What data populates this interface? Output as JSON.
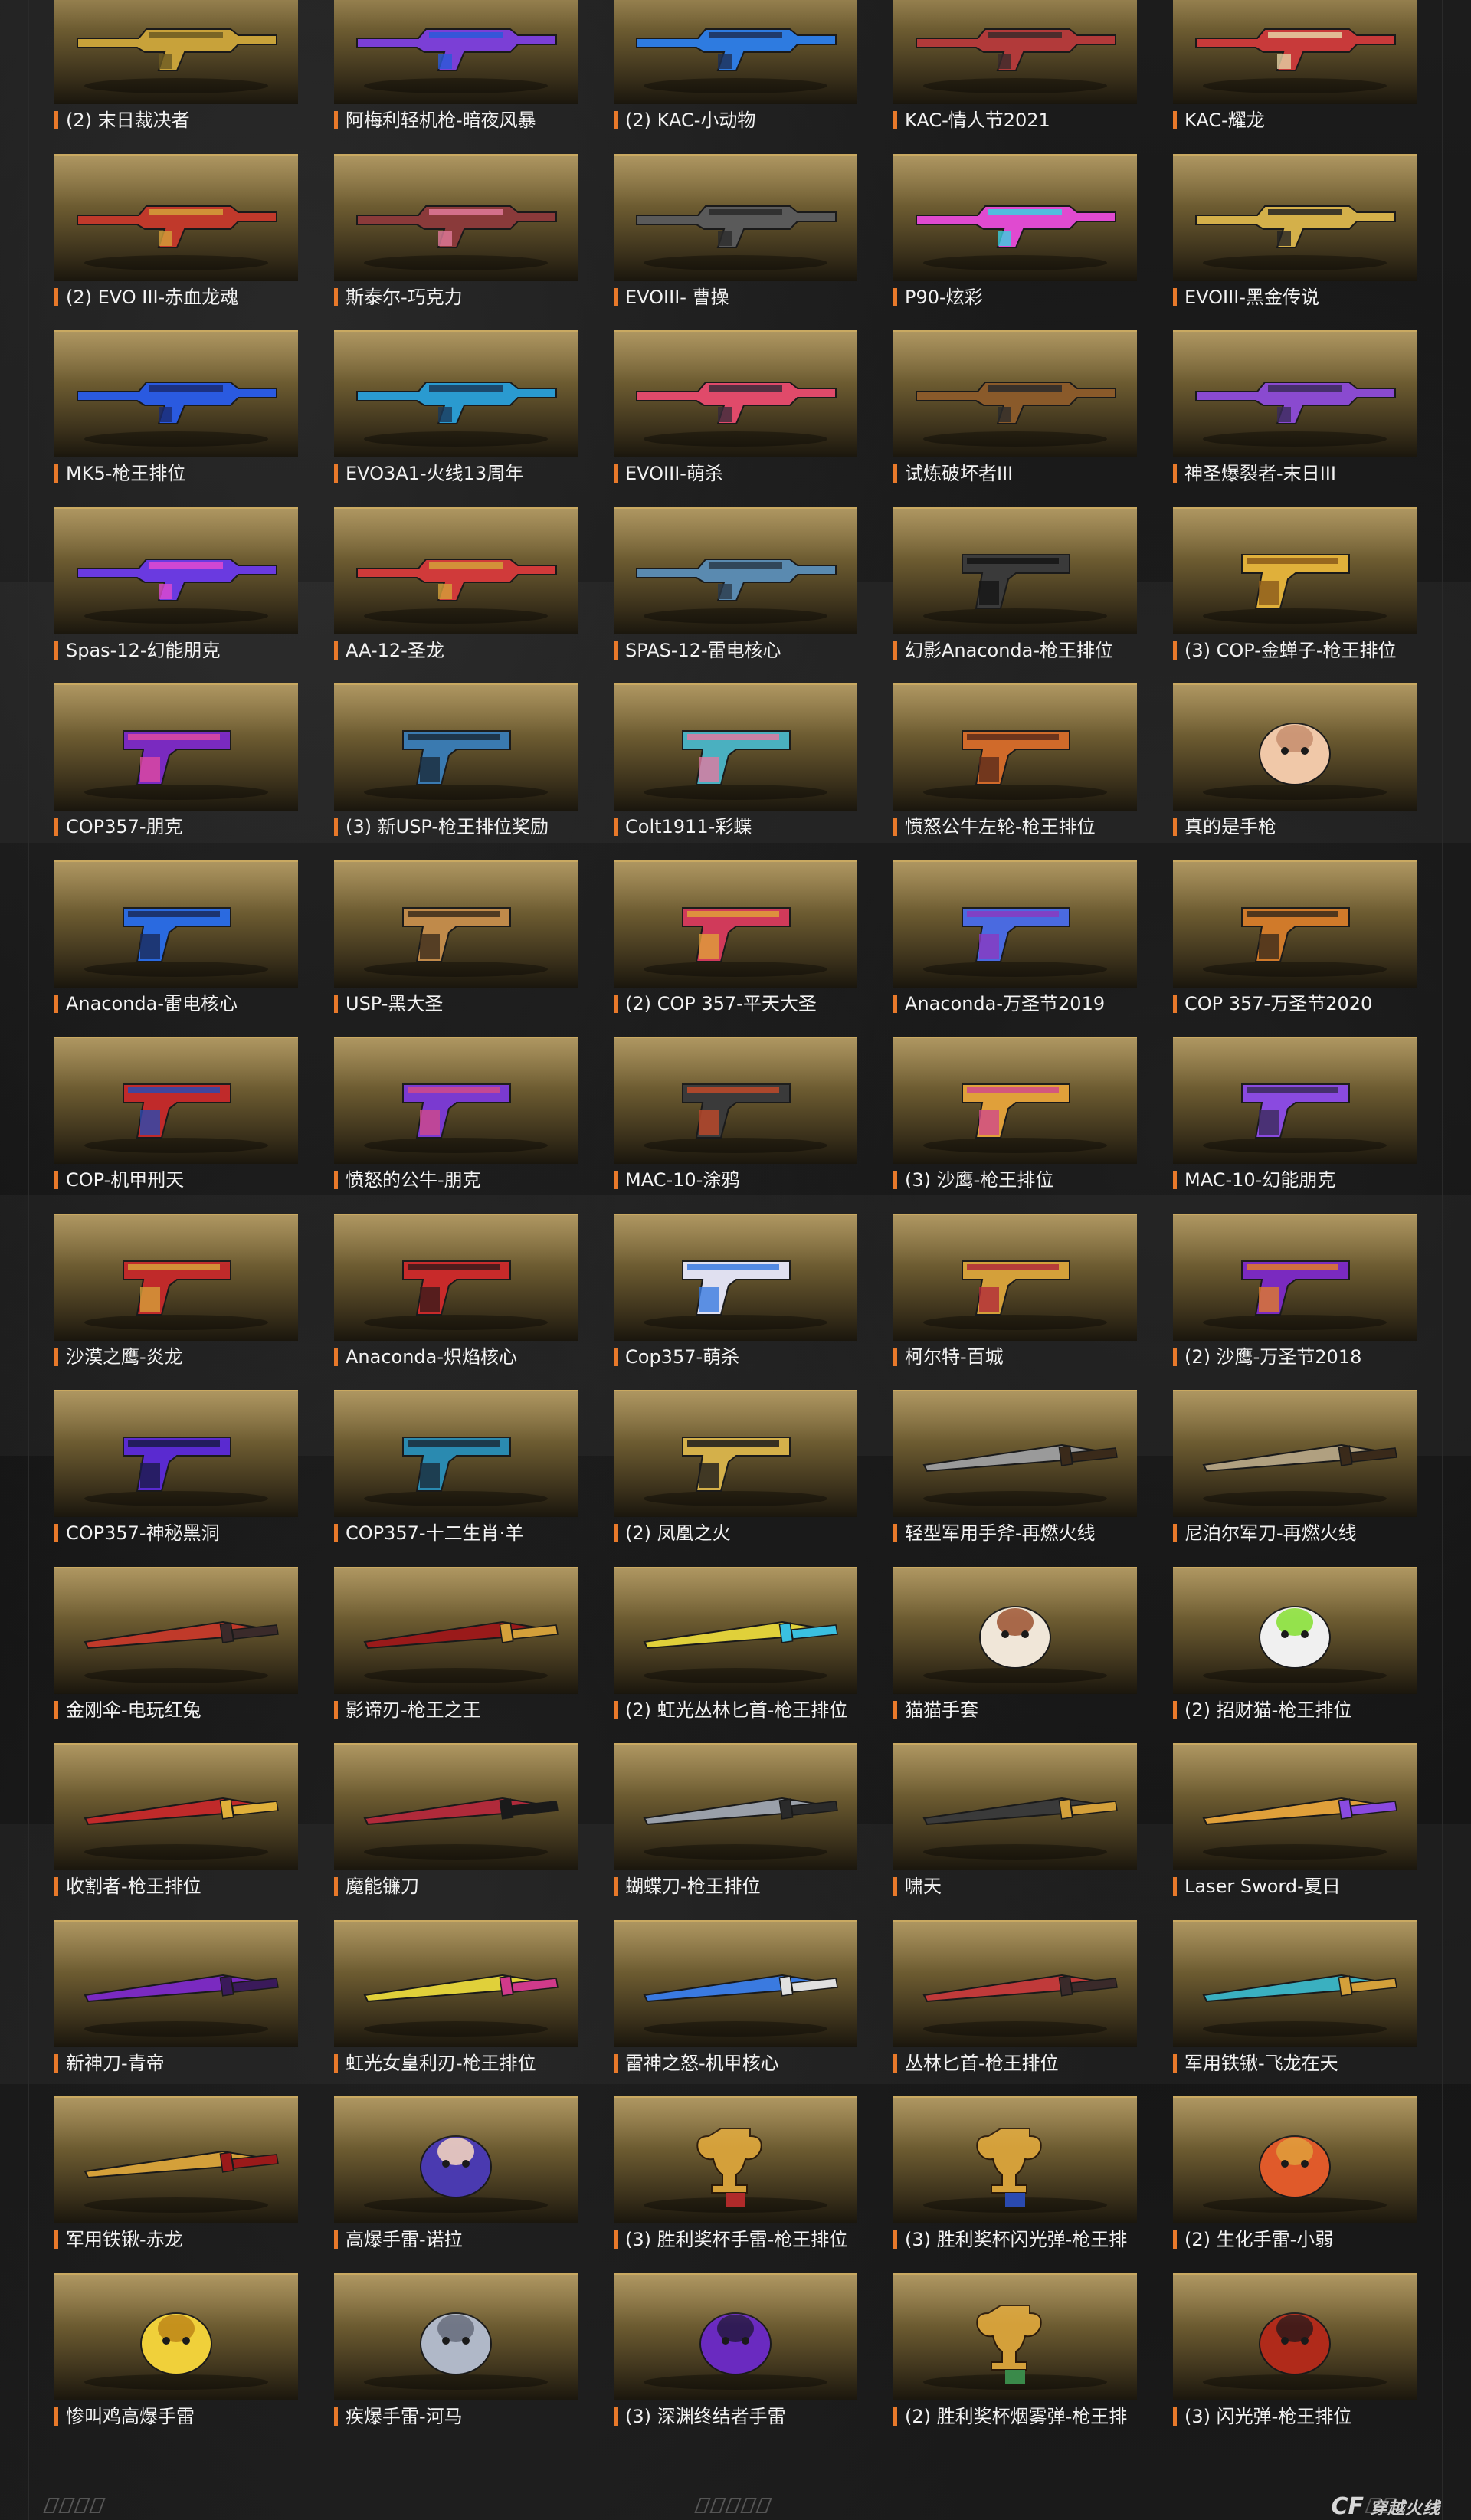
{
  "items": [
    {
      "label": "(2) 末日裁决者",
      "icon": "machine-gun-gold-icon",
      "colors": [
        "#c8a23a",
        "#6b5a22"
      ]
    },
    {
      "label": "阿梅利轻机枪-暗夜风暴",
      "icon": "machine-gun-purple-icon",
      "colors": [
        "#7b3fd6",
        "#2a5ad8"
      ]
    },
    {
      "label": "(2) KAC-小动物",
      "icon": "rifle-blue-icon",
      "colors": [
        "#2e7be0",
        "#1d2f55"
      ]
    },
    {
      "label": "KAC-情人节2021",
      "icon": "rifle-red-icon",
      "colors": [
        "#b23a3a",
        "#3a2a2a"
      ]
    },
    {
      "label": "KAC-耀龙",
      "icon": "rifle-red-white-icon",
      "colors": [
        "#c83a3a",
        "#e5d2a5"
      ]
    },
    {
      "label": "(2) EVO III-赤血龙魂",
      "icon": "smg-red-gold-icon",
      "colors": [
        "#c0392b",
        "#d4a03a"
      ]
    },
    {
      "label": "斯泰尔-巧克力",
      "icon": "smg-chocolate-icon",
      "colors": [
        "#8a3a3a",
        "#e07a9a"
      ]
    },
    {
      "label": "EVOIII- 曹操",
      "icon": "smg-grey-icon",
      "colors": [
        "#5a5a5a",
        "#2a2a2a"
      ]
    },
    {
      "label": "P90-炫彩",
      "icon": "p90-rainbow-icon",
      "colors": [
        "#e04ad0",
        "#3ad0e0"
      ]
    },
    {
      "label": "EVOIII-黑金传说",
      "icon": "smg-black-gold-icon",
      "colors": [
        "#d4b04a",
        "#222222"
      ]
    },
    {
      "label": "MK5-枪王排位",
      "icon": "smg-blue-icon",
      "colors": [
        "#2a5ae0",
        "#1a2a70"
      ]
    },
    {
      "label": "EVO3A1-火线13周年",
      "icon": "smg-cyan-icon",
      "colors": [
        "#2a9ad0",
        "#1a3a5a"
      ]
    },
    {
      "label": "EVOIII-萌杀",
      "icon": "smg-pink-icon",
      "colors": [
        "#e04a6a",
        "#3a2a3a"
      ]
    },
    {
      "label": "试炼破坏者III",
      "icon": "shotgun-brown-icon",
      "colors": [
        "#8a5a2a",
        "#2a2a2a"
      ]
    },
    {
      "label": "神圣爆裂者-末日III",
      "icon": "shotgun-purple-icon",
      "colors": [
        "#8a4ad0",
        "#3a2a5a"
      ]
    },
    {
      "label": "Spas-12-幻能朋克",
      "icon": "shotgun-neon-icon",
      "colors": [
        "#6a3ae0",
        "#e04ad0"
      ]
    },
    {
      "label": "AA-12-圣龙",
      "icon": "shotgun-red-gold-icon",
      "colors": [
        "#d03a3a",
        "#d4a03a"
      ]
    },
    {
      "label": "SPAS-12-雷电核心",
      "icon": "shotgun-steel-blue-icon",
      "colors": [
        "#5a8ab0",
        "#2a3a4a"
      ]
    },
    {
      "label": "幻影Anaconda-枪王排位",
      "icon": "revolver-black-icon",
      "colors": [
        "#3a3a3a",
        "#151515"
      ]
    },
    {
      "label": "(3) COP-金蝉子-枪王排位",
      "icon": "pistol-gold-icon",
      "colors": [
        "#e0b03a",
        "#8a5a1a"
      ]
    },
    {
      "label": "COP357-朋克",
      "icon": "pistol-purple-icon",
      "colors": [
        "#7a2ac0",
        "#e04aa0"
      ]
    },
    {
      "label": "(3) 新USP-枪王排位奖励",
      "icon": "pistol-blue-icon",
      "colors": [
        "#3a7ab0",
        "#1a2a3a"
      ]
    },
    {
      "label": "Colt1911-彩蝶",
      "icon": "pistol-teal-icon",
      "colors": [
        "#4ab0c0",
        "#e07aa0"
      ]
    },
    {
      "label": "愤怒公牛左轮-枪王排位",
      "icon": "revolver-orange-icon",
      "colors": [
        "#d06a2a",
        "#5a2a1a"
      ]
    },
    {
      "label": "真的是手枪",
      "icon": "hand-gesture-icon",
      "colors": [
        "#f0c8a8",
        "#c89070"
      ]
    },
    {
      "label": "Anaconda-雷电核心",
      "icon": "revolver-blue-icon",
      "colors": [
        "#2a6ae0",
        "#1a2a5a"
      ]
    },
    {
      "label": "USP-黑大圣",
      "icon": "pistol-small-gold-icon",
      "colors": [
        "#c08a4a",
        "#3a2a1a"
      ]
    },
    {
      "label": "(2) COP 357-平天大圣",
      "icon": "pistol-red-icon",
      "colors": [
        "#d03a5a",
        "#e0a03a"
      ]
    },
    {
      "label": "Anaconda-万圣节2019",
      "icon": "revolver-purple-blue-icon",
      "colors": [
        "#4a6ae0",
        "#8a3ac0"
      ]
    },
    {
      "label": "COP 357-万圣节2020",
      "icon": "pistol-orange-icon",
      "colors": [
        "#d07a2a",
        "#3a2a1a"
      ]
    },
    {
      "label": "COP-机甲刑天",
      "icon": "pistol-red-blue-icon",
      "colors": [
        "#c02a2a",
        "#2a4ab0"
      ]
    },
    {
      "label": "愤怒的公牛-朋克",
      "icon": "revolver-neon-icon",
      "colors": [
        "#7a3ad0",
        "#d04a8a"
      ]
    },
    {
      "label": "MAC-10-涂鸦",
      "icon": "mac10-dark-icon",
      "colors": [
        "#3a3a3a",
        "#c04a2a"
      ]
    },
    {
      "label": "(3) 沙鹰-枪王排位",
      "icon": "deagle-rainbow-icon",
      "colors": [
        "#e0a03a",
        "#d04a8a"
      ]
    },
    {
      "label": "MAC-10-幻能朋克",
      "icon": "mac10-purple-icon",
      "colors": [
        "#8a4ae0",
        "#3a2a5a"
      ]
    },
    {
      "label": "沙漠之鹰-炎龙",
      "icon": "deagle-red-gold-icon",
      "colors": [
        "#c02a2a",
        "#d4a03a"
      ]
    },
    {
      "label": "Anaconda-炽焰核心",
      "icon": "revolver-red-icon",
      "colors": [
        "#c82a2a",
        "#3a1a1a"
      ]
    },
    {
      "label": "Cop357-萌杀",
      "icon": "pistol-white-blue-icon",
      "colors": [
        "#e0e0f0",
        "#3a7ae0"
      ]
    },
    {
      "label": "柯尔特-百城",
      "icon": "pistol-gold-red-icon",
      "colors": [
        "#d4a03a",
        "#b02a3a"
      ]
    },
    {
      "label": "(2) 沙鹰-万圣节2018",
      "icon": "deagle-purple-orange-icon",
      "colors": [
        "#7a2ac0",
        "#e07a2a"
      ]
    },
    {
      "label": "COP357-神秘黑洞",
      "icon": "pistol-violet-icon",
      "colors": [
        "#5a2ad0",
        "#1a1a4a"
      ]
    },
    {
      "label": "COP357-十二生肖·羊",
      "icon": "pistol-teal-dark-icon",
      "colors": [
        "#2a8ab0",
        "#1a2a3a"
      ]
    },
    {
      "label": "(2) 凤凰之火",
      "icon": "deagle-gold-black-icon",
      "colors": [
        "#d4b04a",
        "#1a1a1a"
      ]
    },
    {
      "label": "轻型军用手斧-再燃火线",
      "icon": "hatchet-icon",
      "colors": [
        "#9a9a9a",
        "#3a2a1a"
      ]
    },
    {
      "label": "尼泊尔军刀-再燃火线",
      "icon": "kukri-icon",
      "colors": [
        "#b0a080",
        "#3a2a1a"
      ]
    },
    {
      "label": "金刚伞-电玩红兔",
      "icon": "umbrella-icon",
      "colors": [
        "#c03a2a",
        "#3a2a2a"
      ]
    },
    {
      "label": "影谛刃-枪王之王",
      "icon": "twin-blade-icon",
      "colors": [
        "#9a1a1a",
        "#d4a03a"
      ]
    },
    {
      "label": "(2) 虹光丛林匕首-枪王排位",
      "icon": "rainbow-knife-icon",
      "colors": [
        "#e0d03a",
        "#3ac0e0"
      ]
    },
    {
      "label": "猫猫手套",
      "icon": "cat-paw-icon",
      "colors": [
        "#f0e6d8",
        "#a05a3a"
      ]
    },
    {
      "label": "(2) 招财猫-枪王排位",
      "icon": "rainbow-paw-icon",
      "colors": [
        "#f0f0f0",
        "#8ae03a"
      ]
    },
    {
      "label": "收割者-枪王排位",
      "icon": "reaper-axe-icon",
      "colors": [
        "#c02a2a",
        "#e0b03a"
      ]
    },
    {
      "label": "魔能镰刀",
      "icon": "scythe-icon",
      "colors": [
        "#b02a3a",
        "#1a1a1a"
      ]
    },
    {
      "label": "蝴蝶刀-枪王排位",
      "icon": "butterfly-knife-icon",
      "colors": [
        "#9aa0aa",
        "#2a2a2a"
      ]
    },
    {
      "label": "啸天",
      "icon": "wolf-claw-icon",
      "colors": [
        "#3a3a3a",
        "#d4a03a"
      ]
    },
    {
      "label": "Laser Sword-夏日",
      "icon": "laser-sword-icon",
      "colors": [
        "#e0a03a",
        "#8a4ae0"
      ]
    },
    {
      "label": "新神刀-青帝",
      "icon": "katana-purple-icon",
      "colors": [
        "#7a2ac0",
        "#3a1a5a"
      ]
    },
    {
      "label": "虹光女皇利刃-枪王排位",
      "icon": "rainbow-twin-blade-icon",
      "colors": [
        "#e0d03a",
        "#d03a8a"
      ]
    },
    {
      "label": "雷神之怒-机甲核心",
      "icon": "mech-hammer-icon",
      "colors": [
        "#3a7ae0",
        "#e0e0e0"
      ]
    },
    {
      "label": "丛林匕首-枪王排位",
      "icon": "jungle-knife-icon",
      "colors": [
        "#c03a3a",
        "#3a2a2a"
      ]
    },
    {
      "label": "军用铁锹-飞龙在天",
      "icon": "shovel-teal-icon",
      "colors": [
        "#3ab0c0",
        "#d4a03a"
      ]
    },
    {
      "label": "军用铁锹-赤龙",
      "icon": "shovel-red-gold-icon",
      "colors": [
        "#d4a03a",
        "#9a1a1a"
      ]
    },
    {
      "label": "高爆手雷-诺拉",
      "icon": "doll-grenade-icon",
      "colors": [
        "#4a3ab0",
        "#f0d0c0"
      ]
    },
    {
      "label": "(3) 胜利奖杯手雷-枪王排位",
      "icon": "trophy-red-icon",
      "colors": [
        "#d4a03a",
        "#b02a2a"
      ]
    },
    {
      "label": "(3) 胜利奖杯闪光弹-枪王排",
      "icon": "trophy-blue-icon",
      "colors": [
        "#d4a03a",
        "#2a4ab0"
      ]
    },
    {
      "label": "(2) 生化手雷-小弱",
      "icon": "demon-grenade-icon",
      "colors": [
        "#e05a2a",
        "#e09a3a"
      ]
    },
    {
      "label": "惨叫鸡高爆手雷",
      "icon": "chicken-grenade-icon",
      "colors": [
        "#f0d03a",
        "#c08a1a"
      ]
    },
    {
      "label": "疾爆手雷-河马",
      "icon": "hippo-grenade-icon",
      "colors": [
        "#b0b8c8",
        "#6a7080"
      ]
    },
    {
      "label": "(3) 深渊终结者手雷",
      "icon": "abyss-grenade-icon",
      "colors": [
        "#6a2ac0",
        "#2a1a4a"
      ]
    },
    {
      "label": "(2) 胜利奖杯烟雾弹-枪王排",
      "icon": "trophy-green-icon",
      "colors": [
        "#d4a03a",
        "#3a8a4a"
      ]
    },
    {
      "label": "(3) 闪光弹-枪王排位",
      "icon": "flash-grenade-icon",
      "colors": [
        "#b02a1a",
        "#3a1a1a"
      ]
    }
  ],
  "footer": {
    "logo_mark": "CF",
    "logo_text": "穿越火线"
  }
}
